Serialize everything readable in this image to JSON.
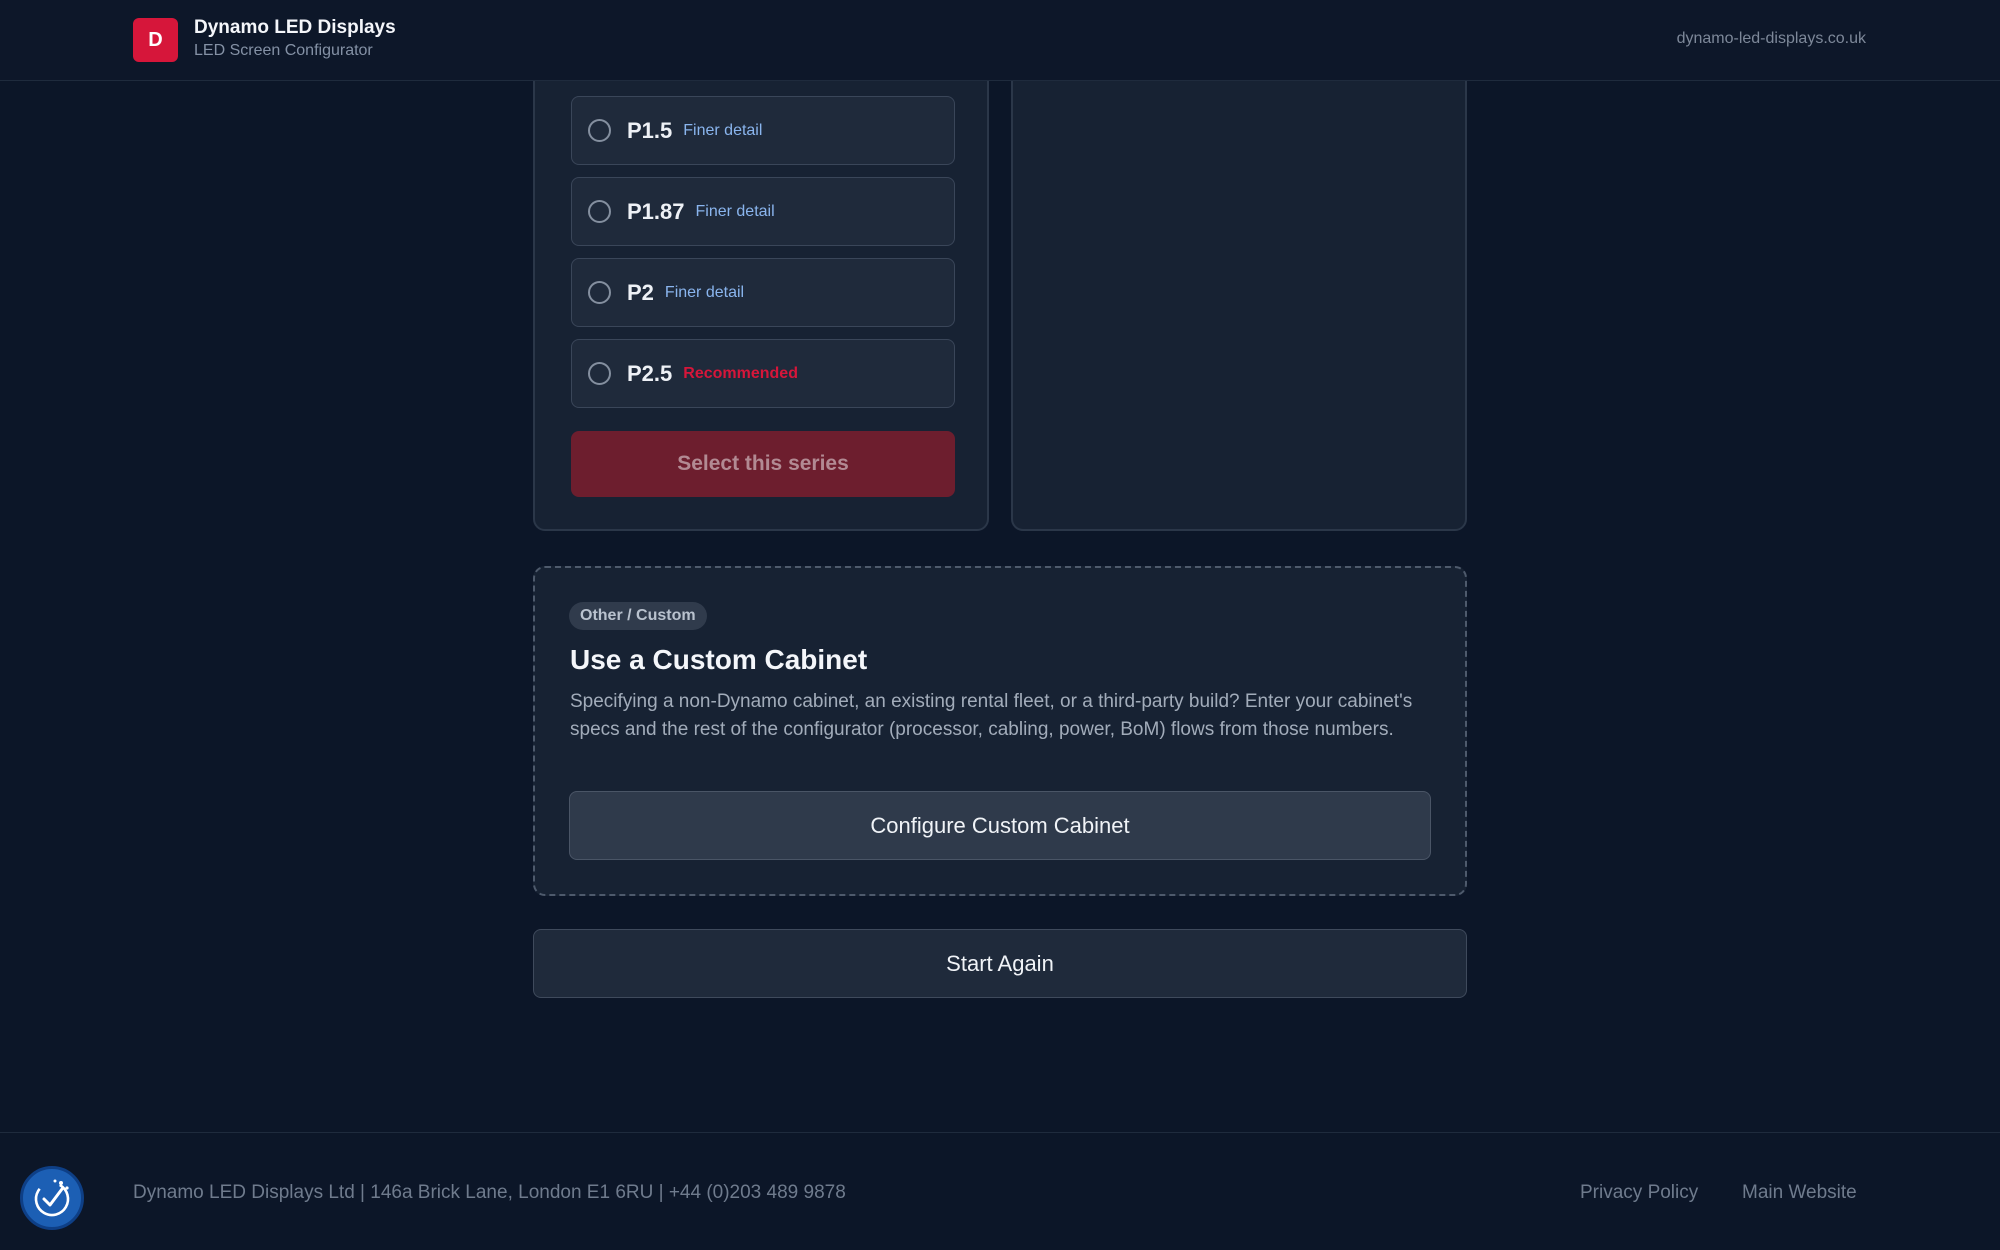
{
  "header": {
    "logo_letter": "D",
    "brand_title": "Dynamo LED Displays",
    "brand_subtitle": "LED Screen Configurator",
    "url": "dynamo-led-displays.co.uk"
  },
  "series_card": {
    "options": [
      {
        "pitch": "P1.5",
        "tag": "Finer detail",
        "tag_type": "fine"
      },
      {
        "pitch": "P1.87",
        "tag": "Finer detail",
        "tag_type": "fine"
      },
      {
        "pitch": "P2",
        "tag": "Finer detail",
        "tag_type": "fine"
      },
      {
        "pitch": "P2.5",
        "tag": "Recommended",
        "tag_type": "recommended"
      }
    ],
    "select_label": "Select this series"
  },
  "custom": {
    "badge": "Other / Custom",
    "title": "Use a Custom Cabinet",
    "description": "Specifying a non-Dynamo cabinet, an existing rental fleet, or a third-party build? Enter your cabinet's specs and the rest of the configurator (processor, cabling, power, BoM) flows from those numbers.",
    "button_label": "Configure Custom Cabinet"
  },
  "start_again_label": "Start Again",
  "footer": {
    "info": "Dynamo LED Displays Ltd | 146a Brick Lane, London E1 6RU | +44 (0)203 489 9878",
    "privacy_label": "Privacy Policy",
    "main_site_label": "Main Website"
  },
  "colors": {
    "background": "#0c1628",
    "accent": "#d6163a",
    "fine_tag": "#8ab5ee",
    "accessibility_button": "#1c5fb4"
  },
  "icons": {
    "accessibility": "accessibility-check-icon"
  }
}
